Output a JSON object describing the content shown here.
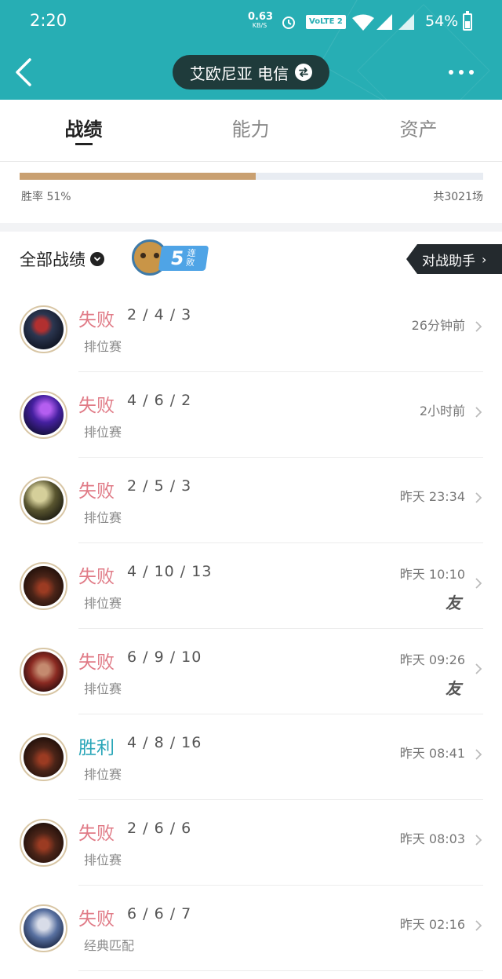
{
  "status_bar": {
    "time": "2:20",
    "net_speed_value": "0.63",
    "net_speed_unit": "KB/S",
    "volte": "VoLTE 2",
    "battery": "54%"
  },
  "header": {
    "server": "艾欧尼亚 电信"
  },
  "tabs": [
    {
      "label": "战绩",
      "active": true
    },
    {
      "label": "能力",
      "active": false
    },
    {
      "label": "资产",
      "active": false
    }
  ],
  "winrate": {
    "label": "胜率  51%",
    "fraction": 0.51,
    "total": "共3021场"
  },
  "list": {
    "filter_label": "全部战绩",
    "streak_number": "5",
    "streak_word": "连败",
    "assistant_label": "对战助手",
    "matches": [
      {
        "result": "失败",
        "outcome": "lose",
        "kda": "2 / 4 / 3",
        "mode": "排位赛",
        "time": "26分钟前",
        "friend": ""
      },
      {
        "result": "失败",
        "outcome": "lose",
        "kda": "4 / 6 / 2",
        "mode": "排位赛",
        "time": "2小时前",
        "friend": ""
      },
      {
        "result": "失败",
        "outcome": "lose",
        "kda": "2 / 5 / 3",
        "mode": "排位赛",
        "time": "昨天 23:34",
        "friend": ""
      },
      {
        "result": "失败",
        "outcome": "lose",
        "kda": "4 / 10 / 13",
        "mode": "排位赛",
        "time": "昨天 10:10",
        "friend": "友"
      },
      {
        "result": "失败",
        "outcome": "lose",
        "kda": "6 / 9 / 10",
        "mode": "排位赛",
        "time": "昨天 09:26",
        "friend": "友"
      },
      {
        "result": "胜利",
        "outcome": "win",
        "kda": "4 / 8 / 16",
        "mode": "排位赛",
        "time": "昨天 08:41",
        "friend": ""
      },
      {
        "result": "失败",
        "outcome": "lose",
        "kda": "2 / 6 / 6",
        "mode": "排位赛",
        "time": "昨天 08:03",
        "friend": ""
      },
      {
        "result": "失败",
        "outcome": "lose",
        "kda": "6 / 6 / 7",
        "mode": "经典匹配",
        "time": "昨天 02:16",
        "friend": ""
      }
    ]
  },
  "colors": {
    "header": "#27aeb4",
    "lose": "#e07a86",
    "win": "#2aa6b8",
    "winrate_fill": "#c9a071"
  }
}
